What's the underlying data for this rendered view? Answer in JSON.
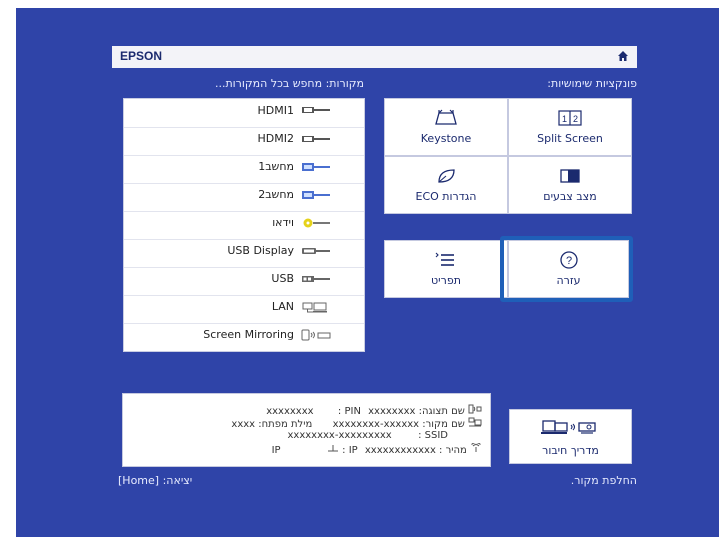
{
  "brand": "EPSON",
  "header": {
    "sources_title": "מקורות: מחפש בכל המקורות...",
    "functions_title": "פונקציות שימושיות:"
  },
  "sources": [
    {
      "label": "HDMI1",
      "icon": "hdmi-icon"
    },
    {
      "label": "HDMI2",
      "icon": "hdmi-icon"
    },
    {
      "label": "מחשב1",
      "icon": "vga-icon"
    },
    {
      "label": "מחשב2",
      "icon": "vga-icon"
    },
    {
      "label": "וידאו",
      "icon": "rca-icon"
    },
    {
      "label": "USB Display",
      "icon": "usb-display-icon"
    },
    {
      "label": "USB",
      "icon": "usb-icon"
    },
    {
      "label": "LAN",
      "icon": "lan-icon"
    },
    {
      "label": "Screen Mirroring",
      "icon": "mirroring-icon"
    }
  ],
  "functions": {
    "split_screen": "Split Screen",
    "keystone": "Keystone",
    "color_mode": "מצב צבעים",
    "eco": "הגדרות ECO",
    "help": "עזרה",
    "menu": "תפריט"
  },
  "info": {
    "display_name_label": "שם תצוגה:",
    "display_name_value": "xxxxxxxx",
    "pin_label": ": PIN",
    "pin_value": "xxxxxxxx",
    "source_name_label": "שם מקור:",
    "source_name_value": "xxxxxxxx-xxxxxx",
    "passphrase_label": "מילת מפתח:",
    "passphrase_value": "xxxx",
    "ssid_label": ": SSID",
    "ssid_value": "xxxxxxxx-xxxxxxxxx",
    "ip_wired_label": ": IP",
    "ip_wired_value": "xxxxxxxxxxxx",
    "speed_label": "מהיר : IP",
    "ip_wireless_value": "xxxxxxxxxxxx"
  },
  "connection_guide": "מדריך חיבור",
  "footer": {
    "switch_source": "החלפת מקור.",
    "exit": "יציאה: [Home]"
  },
  "colors": {
    "background": "#2f44a8",
    "highlight": "#1f5fb8",
    "text_dark": "#1b2a6e"
  }
}
